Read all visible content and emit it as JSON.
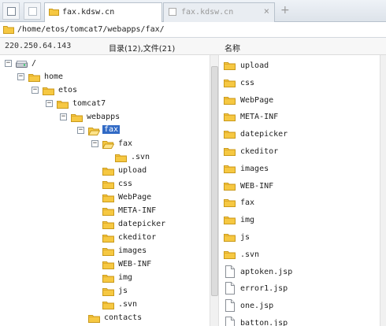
{
  "tabs": [
    {
      "label": "fax.kdsw.cn",
      "active": true
    },
    {
      "label": "fax.kdsw.cn",
      "active": false
    }
  ],
  "new_tab_label": "+",
  "path": "/home/etos/tomcat7/webapps/fax/",
  "info": {
    "ip": "220.250.64.143",
    "counts": "目录(12),文件(21)",
    "column_name": "名称"
  },
  "tree": [
    {
      "label": "/",
      "depth": 0,
      "icon": "drive",
      "expander": "−"
    },
    {
      "label": "home",
      "depth": 1,
      "icon": "folder",
      "expander": "−"
    },
    {
      "label": "etos",
      "depth": 2,
      "icon": "folder",
      "expander": "−"
    },
    {
      "label": "tomcat7",
      "depth": 3,
      "icon": "folder",
      "expander": "−"
    },
    {
      "label": "webapps",
      "depth": 4,
      "icon": "folder",
      "expander": "−"
    },
    {
      "label": "fax",
      "depth": 5,
      "icon": "folder-open",
      "expander": "−",
      "selected": true
    },
    {
      "label": "fax",
      "depth": 6,
      "icon": "folder-open",
      "expander": "−"
    },
    {
      "label": ".svn",
      "depth": 7,
      "icon": "folder"
    },
    {
      "label": "upload",
      "depth": 6,
      "icon": "folder"
    },
    {
      "label": "css",
      "depth": 6,
      "icon": "folder"
    },
    {
      "label": "WebPage",
      "depth": 6,
      "icon": "folder"
    },
    {
      "label": "META-INF",
      "depth": 6,
      "icon": "folder"
    },
    {
      "label": "datepicker",
      "depth": 6,
      "icon": "folder"
    },
    {
      "label": "ckeditor",
      "depth": 6,
      "icon": "folder"
    },
    {
      "label": "images",
      "depth": 6,
      "icon": "folder"
    },
    {
      "label": "WEB-INF",
      "depth": 6,
      "icon": "folder"
    },
    {
      "label": "img",
      "depth": 6,
      "icon": "folder"
    },
    {
      "label": "js",
      "depth": 6,
      "icon": "folder"
    },
    {
      "label": ".svn",
      "depth": 6,
      "icon": "folder"
    },
    {
      "label": "contacts",
      "depth": 5,
      "icon": "folder"
    }
  ],
  "files": [
    {
      "name": "upload",
      "type": "folder"
    },
    {
      "name": "css",
      "type": "folder"
    },
    {
      "name": "WebPage",
      "type": "folder"
    },
    {
      "name": "META-INF",
      "type": "folder"
    },
    {
      "name": "datepicker",
      "type": "folder"
    },
    {
      "name": "ckeditor",
      "type": "folder"
    },
    {
      "name": "images",
      "type": "folder"
    },
    {
      "name": "WEB-INF",
      "type": "folder"
    },
    {
      "name": "fax",
      "type": "folder"
    },
    {
      "name": "img",
      "type": "folder"
    },
    {
      "name": "js",
      "type": "folder"
    },
    {
      "name": ".svn",
      "type": "folder"
    },
    {
      "name": "aptoken.jsp",
      "type": "file"
    },
    {
      "name": "error1.jsp",
      "type": "file"
    },
    {
      "name": "one.jsp",
      "type": "file"
    },
    {
      "name": "batton.jsp",
      "type": "file"
    }
  ],
  "colors": {
    "folder": "#f6c842",
    "folder_edge": "#c99a1b",
    "selection": "#316ac5"
  }
}
